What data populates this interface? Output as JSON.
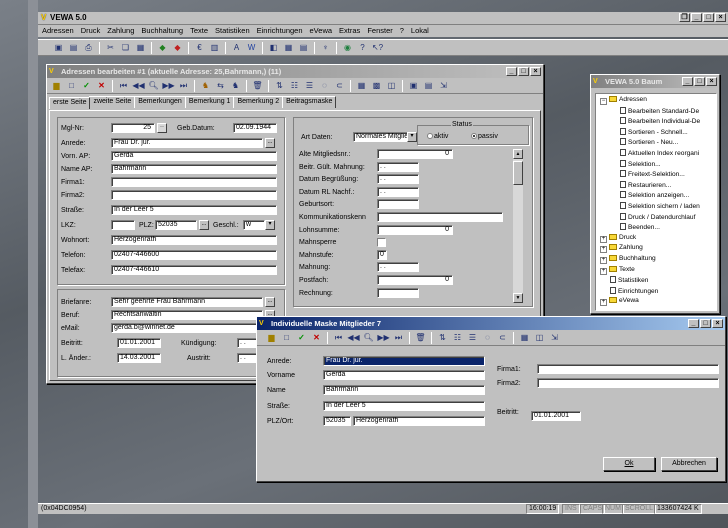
{
  "app": {
    "title": "VEWA 5.0",
    "menu": [
      "Adressen",
      "Druck",
      "Zahlung",
      "Buchhaltung",
      "Texte",
      "Statistiken",
      "Einrichtungen",
      "eVewa",
      "Extras",
      "Fenster",
      "?",
      "Lokal"
    ]
  },
  "main_window": {
    "title": "Adressen bearbeiten #1 (aktuelle Adresse: 25,Bahrmann,) (11)",
    "tabs": [
      "erste Seite",
      "zweite Seite",
      "Bemerkungen",
      "Bemerkung 1",
      "Bemerkung 2",
      "Beitragsmaske"
    ],
    "fields": {
      "mgl_nr_label": "Mgl-Nr:",
      "mgl_nr": "25",
      "geb_label": "Geb.Datum:",
      "geb": "02.09.1944",
      "anrede_label": "Anrede:",
      "anrede": "Frau Dr. jur.",
      "vorn_label": "Vorn. AP:",
      "vorn": "Gerda",
      "name_label": "Name AP:",
      "name": "Bahrmann",
      "firma1_label": "Firma1:",
      "firma1": "",
      "firma2_label": "Firma2:",
      "firma2": "",
      "strasse_label": "Straße:",
      "strasse": "In der Leer 5",
      "lkz_label": "LKZ:",
      "lkz": "",
      "plz_label": "PLZ:",
      "plz": "52035",
      "geschl_label": "Geschl.:",
      "geschl": "w",
      "wohnort_label": "Wohnort:",
      "wohnort": "Herzogenrath",
      "telefon_label": "Telefon:",
      "telefon": "02407-446600",
      "telefax_label": "Telefax:",
      "telefax": "02407-446610",
      "briefanrede_label": "Briefanre:",
      "briefanrede": "Sehr geehrte Frau Bahrmann",
      "beruf_label": "Beruf:",
      "beruf": "Rechtsanwältin",
      "email_label": "eMail:",
      "email": "gerda.b@winnet.de",
      "beitritt_label": "Beitritt:",
      "beitritt": "01.01.2001",
      "kuendigung_label": "Kündigung:",
      "kuendigung": ". .",
      "aender_label": "L. Änder.:",
      "aender": "14.03.2001",
      "austritt_label": "Austritt:",
      "austritt": ". ."
    },
    "right": {
      "art_label": "Art Daten:",
      "art": "Normales Mitglied",
      "status_label": "Status",
      "aktiv": "aktiv",
      "passiv": "passiv",
      "rows": [
        {
          "label": "Alte Mitgliedsnr.:",
          "value": "0"
        },
        {
          "label": "Beitr. Gült. Mahnung:",
          "value": ". ."
        },
        {
          "label": "Datum Begrüßung:",
          "value": ". ."
        },
        {
          "label": "Datum RL Nachf.:",
          "value": ". ."
        },
        {
          "label": "Geburtsort:",
          "value": ""
        },
        {
          "label": "Kommunikationskenn",
          "value": ""
        },
        {
          "label": "Lohnsumme:",
          "value": "0"
        },
        {
          "label": "Mahnsperre",
          "value": ""
        },
        {
          "label": "Mahnstufe:",
          "value": "0"
        },
        {
          "label": "Mahnung:",
          "value": ". ."
        },
        {
          "label": "Postfach:",
          "value": "0"
        },
        {
          "label": "Rechnung:",
          "value": ""
        }
      ]
    }
  },
  "tree_window": {
    "title": "VEWA 5.0 Baum",
    "items": [
      {
        "type": "folder-open",
        "label": "Adressen",
        "level": 0
      },
      {
        "type": "doc",
        "label": "Bearbeiten Standard-De",
        "level": 2
      },
      {
        "type": "doc",
        "label": "Bearbeiten Individual-De",
        "level": 2
      },
      {
        "type": "doc",
        "label": "Sortieren - Schnell...",
        "level": 2
      },
      {
        "type": "doc",
        "label": "Sortieren - Neu...",
        "level": 2
      },
      {
        "type": "doc",
        "label": "Aktuellen Index reorgani",
        "level": 2
      },
      {
        "type": "doc",
        "label": "Selektion...",
        "level": 2
      },
      {
        "type": "doc",
        "label": "Freitext-Selektion...",
        "level": 2
      },
      {
        "type": "doc",
        "label": "Restaurieren...",
        "level": 2
      },
      {
        "type": "doc",
        "label": "Selektion anzeigen...",
        "level": 2
      },
      {
        "type": "doc",
        "label": "Selektion sichern / laden",
        "level": 2
      },
      {
        "type": "doc",
        "label": "Druck / Datendurchlauf",
        "level": 2
      },
      {
        "type": "doc",
        "label": "Beenden...",
        "level": 2
      },
      {
        "type": "folder",
        "label": "Druck",
        "level": 0
      },
      {
        "type": "folder",
        "label": "Zahlung",
        "level": 0
      },
      {
        "type": "folder",
        "label": "Buchhaltung",
        "level": 0
      },
      {
        "type": "folder",
        "label": "Texte",
        "level": 0
      },
      {
        "type": "doc",
        "label": "Statistiken",
        "level": 1
      },
      {
        "type": "doc",
        "label": "Einrichtungen",
        "level": 1
      },
      {
        "type": "folder",
        "label": "eVewa",
        "level": 0
      }
    ]
  },
  "mask_window": {
    "title": "Individuelle Maske Mitglieder 7",
    "anrede_label": "Anrede:",
    "anrede": "Frau Dr. jur.",
    "vorname_label": "Vorname",
    "vorname": "Gerda",
    "name_label": "Name",
    "name": "Bahrmann",
    "strasse_label": "Straße:",
    "strasse": "In der Leer 5",
    "plz_label": "PLZ/Ort:",
    "plz": "52035",
    "ort": "Herzogenrath",
    "firma1_label": "Firma1:",
    "firma1": "",
    "firma2_label": "Firma2:",
    "firma2": "",
    "beitritt_label": "Beitritt:",
    "beitritt": "01.01.2001",
    "ok": "Ok",
    "abbrechen": "Abbrechen"
  },
  "status_bar": {
    "left": "(0x04DC0954)",
    "time": "16:00:19",
    "ins": "INS",
    "caps": "CAPS",
    "num": "NUM",
    "scroll": "SCROLL",
    "mem": "133607424 K"
  }
}
